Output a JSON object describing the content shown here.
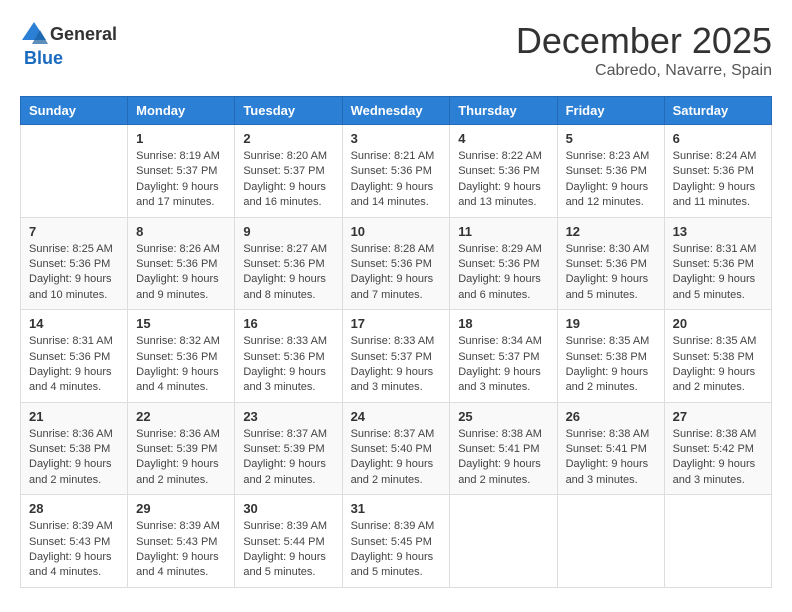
{
  "header": {
    "logo": {
      "general": "General",
      "blue": "Blue"
    },
    "title": "December 2025",
    "location": "Cabredo, Navarre, Spain"
  },
  "weekdays": [
    "Sunday",
    "Monday",
    "Tuesday",
    "Wednesday",
    "Thursday",
    "Friday",
    "Saturday"
  ],
  "weeks": [
    [
      {
        "day": "",
        "info": ""
      },
      {
        "day": "1",
        "info": "Sunrise: 8:19 AM\nSunset: 5:37 PM\nDaylight: 9 hours\nand 17 minutes."
      },
      {
        "day": "2",
        "info": "Sunrise: 8:20 AM\nSunset: 5:37 PM\nDaylight: 9 hours\nand 16 minutes."
      },
      {
        "day": "3",
        "info": "Sunrise: 8:21 AM\nSunset: 5:36 PM\nDaylight: 9 hours\nand 14 minutes."
      },
      {
        "day": "4",
        "info": "Sunrise: 8:22 AM\nSunset: 5:36 PM\nDaylight: 9 hours\nand 13 minutes."
      },
      {
        "day": "5",
        "info": "Sunrise: 8:23 AM\nSunset: 5:36 PM\nDaylight: 9 hours\nand 12 minutes."
      },
      {
        "day": "6",
        "info": "Sunrise: 8:24 AM\nSunset: 5:36 PM\nDaylight: 9 hours\nand 11 minutes."
      }
    ],
    [
      {
        "day": "7",
        "info": "Sunrise: 8:25 AM\nSunset: 5:36 PM\nDaylight: 9 hours\nand 10 minutes."
      },
      {
        "day": "8",
        "info": "Sunrise: 8:26 AM\nSunset: 5:36 PM\nDaylight: 9 hours\nand 9 minutes."
      },
      {
        "day": "9",
        "info": "Sunrise: 8:27 AM\nSunset: 5:36 PM\nDaylight: 9 hours\nand 8 minutes."
      },
      {
        "day": "10",
        "info": "Sunrise: 8:28 AM\nSunset: 5:36 PM\nDaylight: 9 hours\nand 7 minutes."
      },
      {
        "day": "11",
        "info": "Sunrise: 8:29 AM\nSunset: 5:36 PM\nDaylight: 9 hours\nand 6 minutes."
      },
      {
        "day": "12",
        "info": "Sunrise: 8:30 AM\nSunset: 5:36 PM\nDaylight: 9 hours\nand 5 minutes."
      },
      {
        "day": "13",
        "info": "Sunrise: 8:31 AM\nSunset: 5:36 PM\nDaylight: 9 hours\nand 5 minutes."
      }
    ],
    [
      {
        "day": "14",
        "info": "Sunrise: 8:31 AM\nSunset: 5:36 PM\nDaylight: 9 hours\nand 4 minutes."
      },
      {
        "day": "15",
        "info": "Sunrise: 8:32 AM\nSunset: 5:36 PM\nDaylight: 9 hours\nand 4 minutes."
      },
      {
        "day": "16",
        "info": "Sunrise: 8:33 AM\nSunset: 5:36 PM\nDaylight: 9 hours\nand 3 minutes."
      },
      {
        "day": "17",
        "info": "Sunrise: 8:33 AM\nSunset: 5:37 PM\nDaylight: 9 hours\nand 3 minutes."
      },
      {
        "day": "18",
        "info": "Sunrise: 8:34 AM\nSunset: 5:37 PM\nDaylight: 9 hours\nand 3 minutes."
      },
      {
        "day": "19",
        "info": "Sunrise: 8:35 AM\nSunset: 5:38 PM\nDaylight: 9 hours\nand 2 minutes."
      },
      {
        "day": "20",
        "info": "Sunrise: 8:35 AM\nSunset: 5:38 PM\nDaylight: 9 hours\nand 2 minutes."
      }
    ],
    [
      {
        "day": "21",
        "info": "Sunrise: 8:36 AM\nSunset: 5:38 PM\nDaylight: 9 hours\nand 2 minutes."
      },
      {
        "day": "22",
        "info": "Sunrise: 8:36 AM\nSunset: 5:39 PM\nDaylight: 9 hours\nand 2 minutes."
      },
      {
        "day": "23",
        "info": "Sunrise: 8:37 AM\nSunset: 5:39 PM\nDaylight: 9 hours\nand 2 minutes."
      },
      {
        "day": "24",
        "info": "Sunrise: 8:37 AM\nSunset: 5:40 PM\nDaylight: 9 hours\nand 2 minutes."
      },
      {
        "day": "25",
        "info": "Sunrise: 8:38 AM\nSunset: 5:41 PM\nDaylight: 9 hours\nand 2 minutes."
      },
      {
        "day": "26",
        "info": "Sunrise: 8:38 AM\nSunset: 5:41 PM\nDaylight: 9 hours\nand 3 minutes."
      },
      {
        "day": "27",
        "info": "Sunrise: 8:38 AM\nSunset: 5:42 PM\nDaylight: 9 hours\nand 3 minutes."
      }
    ],
    [
      {
        "day": "28",
        "info": "Sunrise: 8:39 AM\nSunset: 5:43 PM\nDaylight: 9 hours\nand 4 minutes."
      },
      {
        "day": "29",
        "info": "Sunrise: 8:39 AM\nSunset: 5:43 PM\nDaylight: 9 hours\nand 4 minutes."
      },
      {
        "day": "30",
        "info": "Sunrise: 8:39 AM\nSunset: 5:44 PM\nDaylight: 9 hours\nand 5 minutes."
      },
      {
        "day": "31",
        "info": "Sunrise: 8:39 AM\nSunset: 5:45 PM\nDaylight: 9 hours\nand 5 minutes."
      },
      {
        "day": "",
        "info": ""
      },
      {
        "day": "",
        "info": ""
      },
      {
        "day": "",
        "info": ""
      }
    ]
  ]
}
